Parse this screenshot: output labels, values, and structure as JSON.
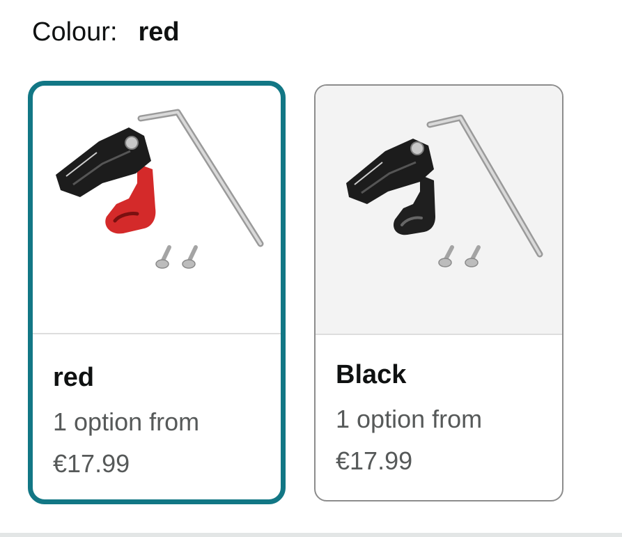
{
  "colour_selector": {
    "label": "Colour:",
    "selected_value": "red"
  },
  "options": [
    {
      "name": "red",
      "subtitle": "1 option from",
      "price": "€17.99",
      "selected": true,
      "hanger_color": "#d42a2a"
    },
    {
      "name": "Black",
      "subtitle": "1 option from",
      "price": "€17.99",
      "selected": false,
      "hanger_color": "#1f1f1f"
    }
  ],
  "colors": {
    "selected_border": "#127785",
    "unselected_border": "#8c8c8c",
    "text_primary": "#0f1111",
    "text_secondary": "#565959"
  }
}
